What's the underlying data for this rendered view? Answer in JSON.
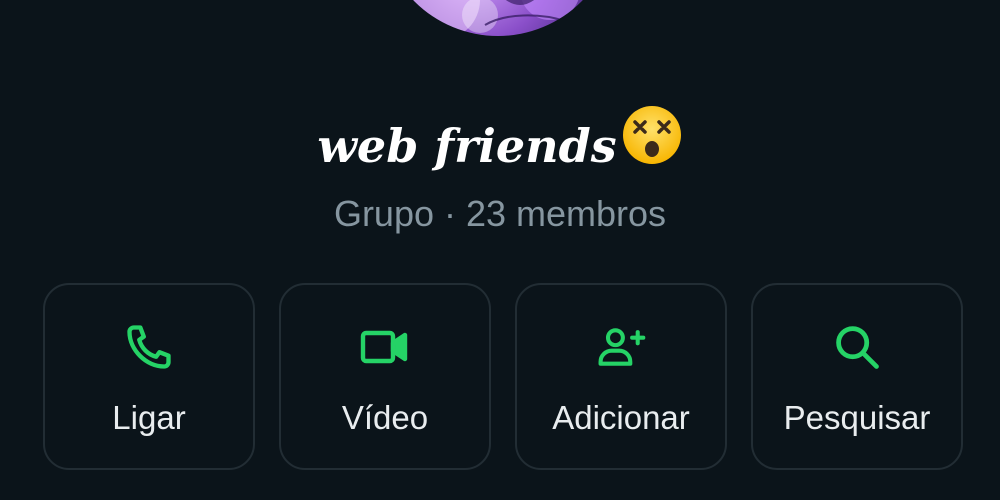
{
  "group": {
    "name": "web friends",
    "emoji": "😵",
    "subtitle": "Grupo · 23 membros"
  },
  "actions": [
    {
      "label": "Ligar",
      "icon": "phone-icon"
    },
    {
      "label": "Vídeo",
      "icon": "video-camera-icon"
    },
    {
      "label": "Adicionar",
      "icon": "add-person-icon"
    },
    {
      "label": "Pesquisar",
      "icon": "search-icon"
    }
  ],
  "colors": {
    "background": "#0b141a",
    "accent": "#25d366",
    "text_primary": "#ffffff",
    "text_secondary": "#8696a0",
    "card_border": "#222d34"
  }
}
